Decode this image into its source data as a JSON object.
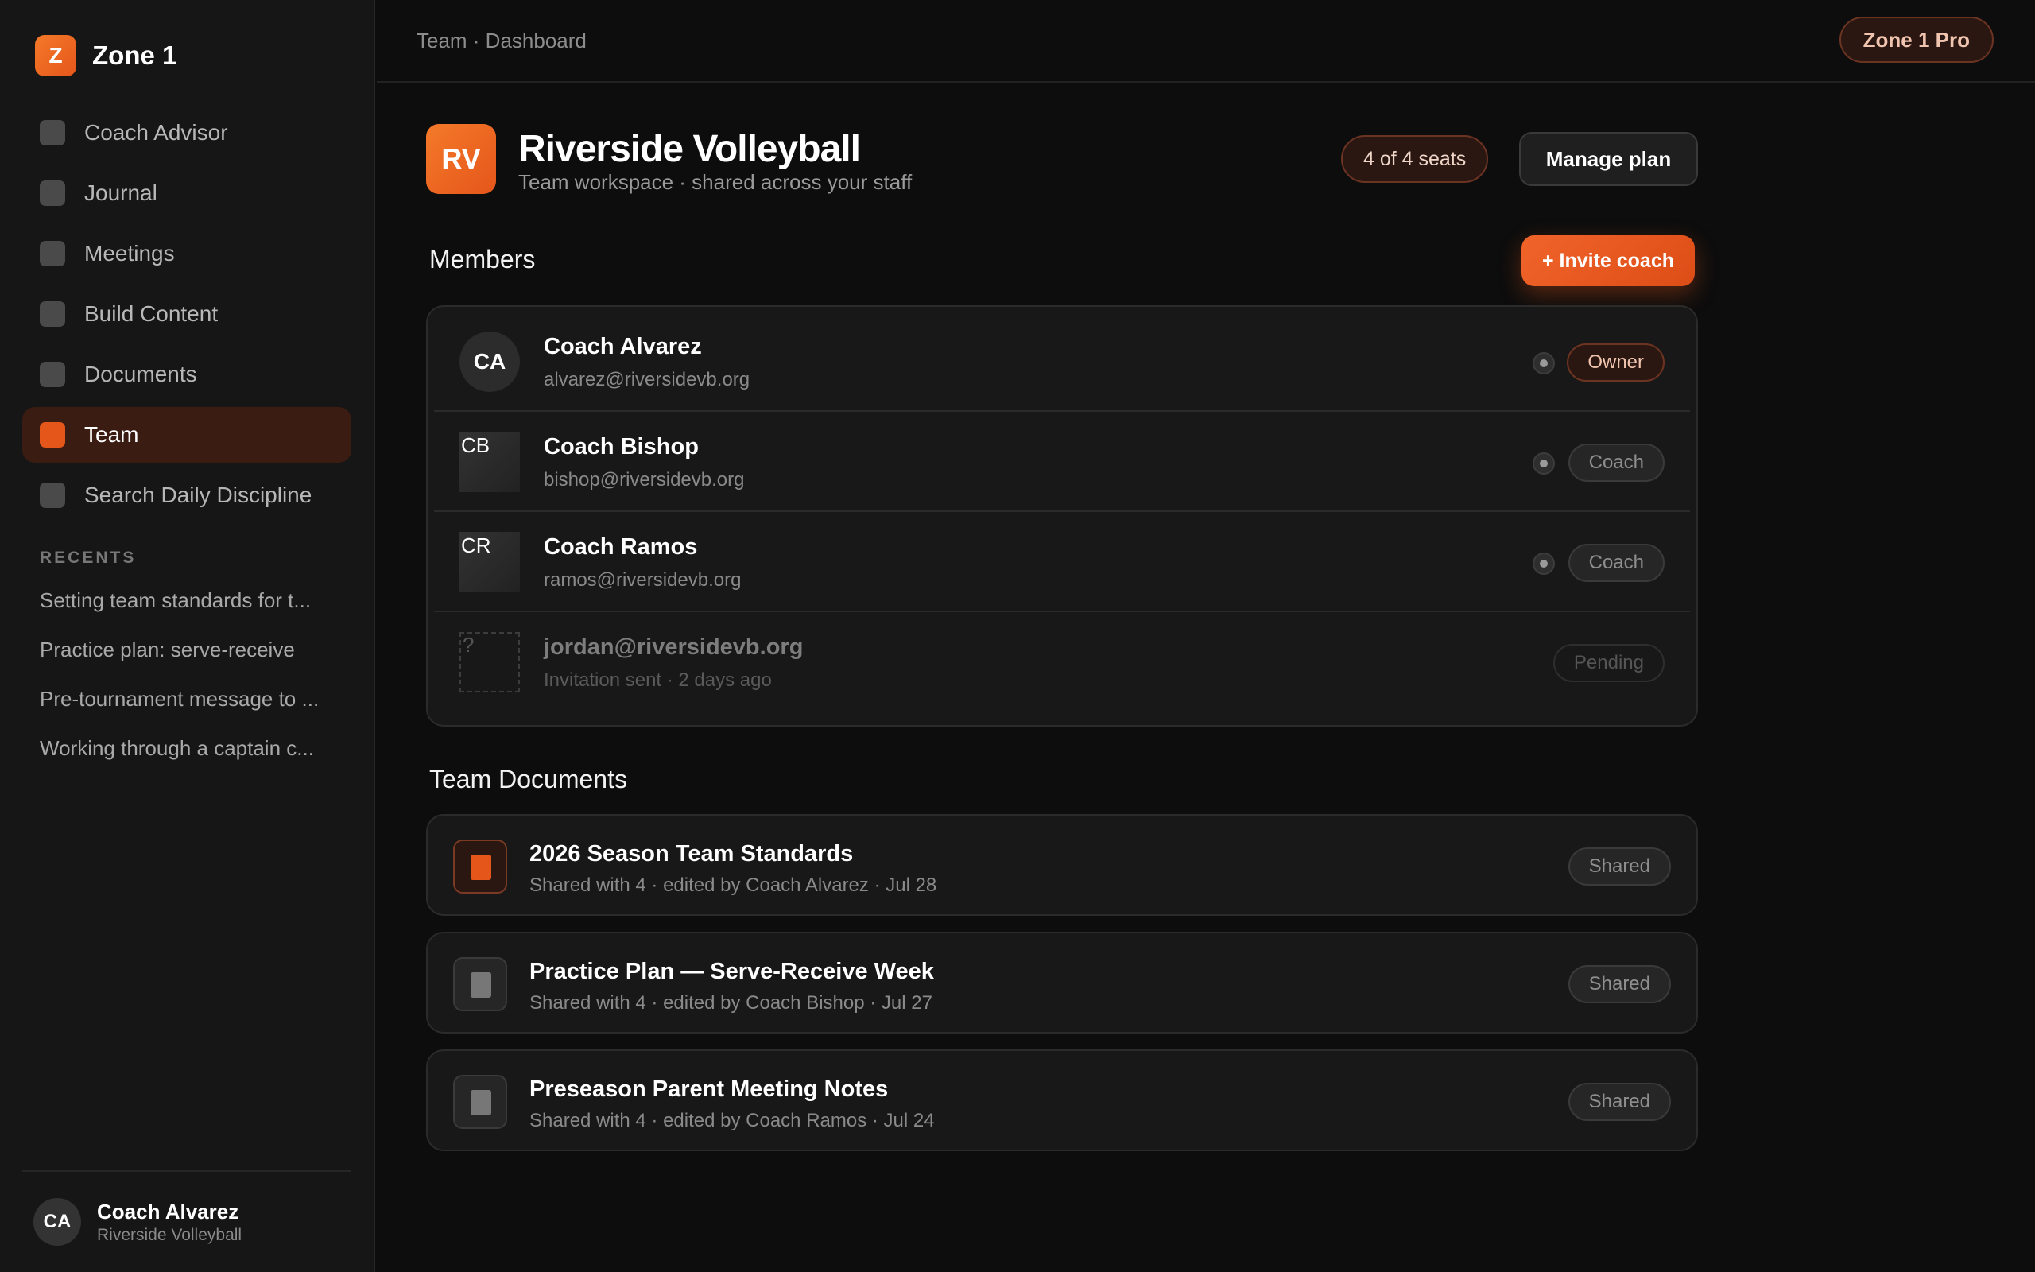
{
  "app": {
    "logo_letter": "Z",
    "name": "Zone 1"
  },
  "sidebar": {
    "items": [
      {
        "label": "Coach Advisor",
        "active": false
      },
      {
        "label": "Journal",
        "active": false
      },
      {
        "label": "Meetings",
        "active": false
      },
      {
        "label": "Build Content",
        "active": false
      },
      {
        "label": "Documents",
        "active": false
      },
      {
        "label": "Team",
        "active": true
      },
      {
        "label": "Search Daily Discipline",
        "active": false
      }
    ],
    "recents_title": "RECENTS",
    "recents": [
      "Setting team standards for t...",
      "Practice plan: serve-receive",
      "Pre-tournament message to ...",
      "Working through a captain c..."
    ],
    "user": {
      "initials": "CA",
      "name": "Coach Alvarez",
      "team": "Riverside Volleyball"
    }
  },
  "topbar": {
    "breadcrumb": "Team · Dashboard",
    "plan_badge": "Zone 1 Pro"
  },
  "team": {
    "initials": "RV",
    "name": "Riverside Volleyball",
    "subtitle": "Team workspace · shared across your staff",
    "seats": "4 of 4 seats",
    "manage_label": "Manage plan"
  },
  "members": {
    "title": "Members",
    "invite_label": "+ Invite coach",
    "rows": [
      {
        "initials": "CA",
        "name": "Coach Alvarez",
        "email": "alvarez@riversidevb.org",
        "role": "Owner"
      },
      {
        "initials": "CB",
        "name": "Coach Bishop",
        "email": "bishop@riversidevb.org",
        "role": "Coach"
      },
      {
        "initials": "CR",
        "name": "Coach Ramos",
        "email": "ramos@riversidevb.org",
        "role": "Coach"
      },
      {
        "initials": "?",
        "name": "jordan@riversidevb.org",
        "email": "Invitation sent · 2 days ago",
        "role": "Pending"
      }
    ]
  },
  "documents": {
    "title": "Team Documents",
    "items": [
      {
        "title": "2026 Season Team Standards",
        "meta": "Shared with 4 · edited by Coach Alvarez · Jul 28",
        "badge": "Shared"
      },
      {
        "title": "Practice Plan — Serve-Receive Week",
        "meta": "Shared with 4 · edited by Coach Bishop · Jul 27",
        "badge": "Shared"
      },
      {
        "title": "Preseason Parent Meeting Notes",
        "meta": "Shared with 4 · edited by Coach Ramos · Jul 24",
        "badge": "Shared"
      }
    ]
  },
  "colors": {
    "accent": "#e5561a",
    "background": "#0d0d0d",
    "sidebar": "#161616",
    "card": "#181818"
  }
}
